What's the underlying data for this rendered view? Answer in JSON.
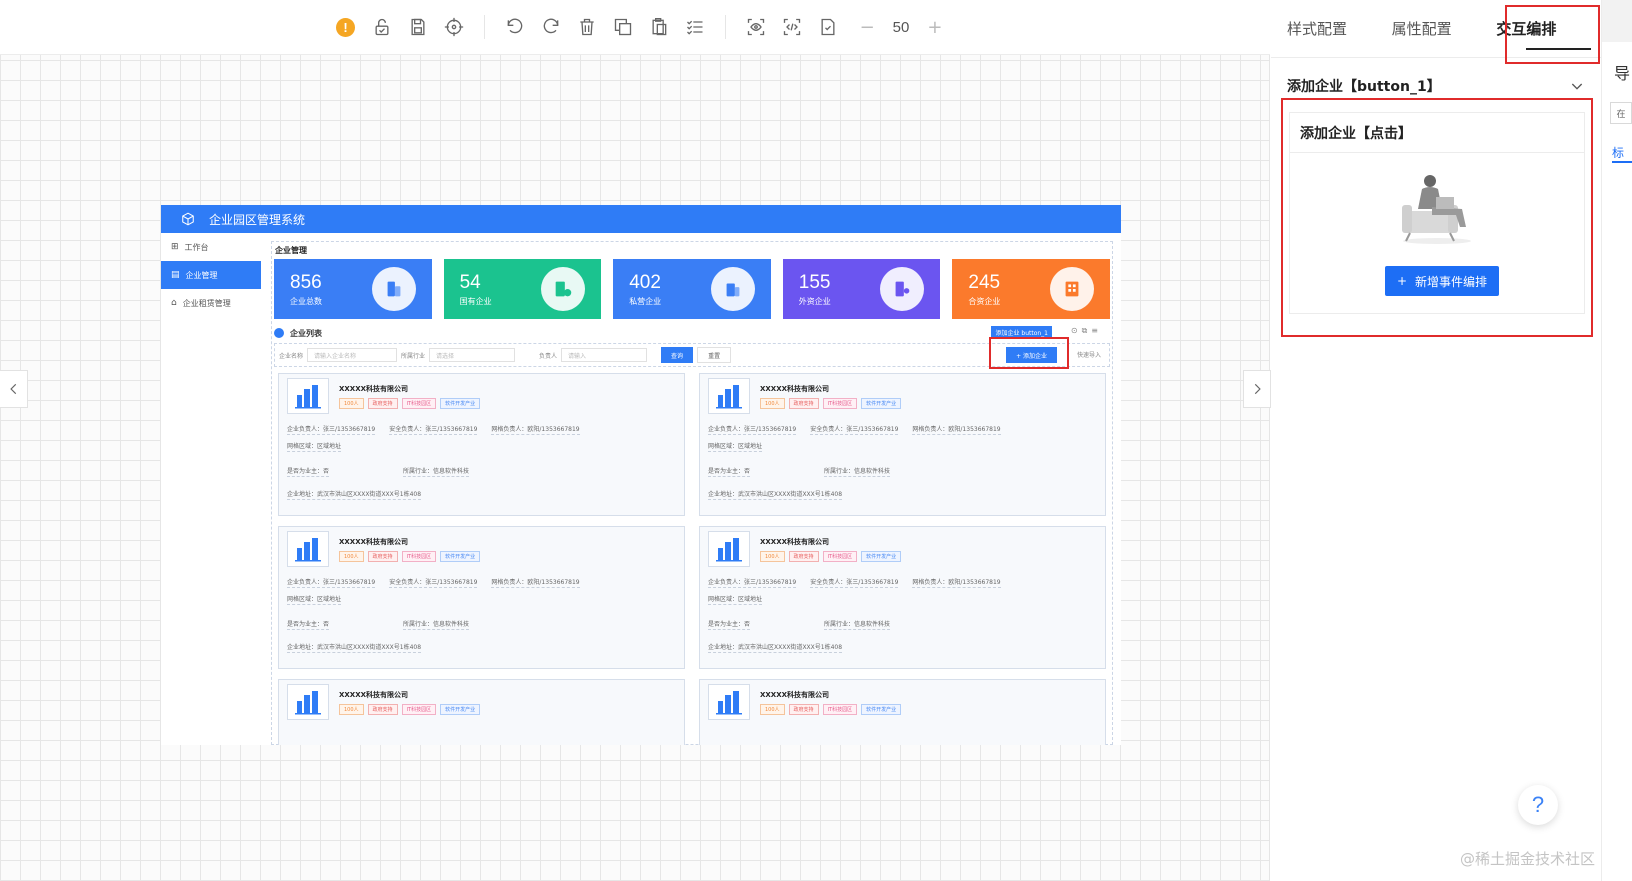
{
  "toolbar": {
    "warning": "!",
    "zoom_value": "50",
    "zoom_minus": "−",
    "zoom_plus": "+"
  },
  "preview": {
    "app_title": "企业园区管理系统",
    "sidebar": [
      {
        "icon": "⊞",
        "label": "工作台",
        "active": false
      },
      {
        "icon": "▤",
        "label": "企业管理",
        "active": true
      },
      {
        "icon": "⌂",
        "label": "企业租赁管理",
        "active": false
      }
    ],
    "main_title": "企业管理",
    "stats": [
      {
        "value": "856",
        "label": "企业总数",
        "color": "#3a7ef5"
      },
      {
        "value": "54",
        "label": "国有企业",
        "color": "#1bc38f"
      },
      {
        "value": "402",
        "label": "私营企业",
        "color": "#3a7ef5"
      },
      {
        "value": "155",
        "label": "外资企业",
        "color": "#6b55f0"
      },
      {
        "value": "245",
        "label": "合资企业",
        "color": "#fb7a2c"
      }
    ],
    "list_title": "企业列表",
    "selected_chip": "添加企业 button_1",
    "search": {
      "name_label": "企业名称",
      "name_placeholder": "请输入企业名称",
      "industry_label": "所属行业",
      "industry_placeholder": "请选择",
      "owner_label": "负责人",
      "owner_placeholder": "请输入",
      "query_btn": "查询",
      "reset_btn": "重置",
      "add_btn": "+ 添加企业",
      "import_btn": "快速导入"
    },
    "company": {
      "name": "XXXXX科技有限公司",
      "tags": [
        "100人",
        "政府支持",
        "IT科技园区",
        "软件开发产业"
      ],
      "row1": [
        "企业负责人：张三/1353667819",
        "安全负责人：张三/1353667819",
        "网格负责人：欧阳/1353667819"
      ],
      "row2": [
        "网格区域：区域地址"
      ],
      "row3": [
        "是否为业主：否",
        "所属行业：信息软件科技"
      ],
      "row4": [
        "企业地址：武汉市洪山区XXXX街道XXX号1栋408"
      ]
    }
  },
  "right_panel": {
    "tabs": [
      "样式配置",
      "属性配置",
      "交互编排"
    ],
    "active_tab": "交互编排",
    "selected_component": "添加企业【button_1】",
    "event_title": "添加企业【点击】",
    "add_event_btn": "新增事件编排"
  },
  "far_right": {
    "char1": "导",
    "char2": "在",
    "link": "标"
  },
  "help": "?",
  "watermark": "@稀土掘金技术社区",
  "colors": {
    "primary": "#2f7cf6",
    "highlight": "#e02b2b",
    "button_blue": "#1d6ef5"
  }
}
